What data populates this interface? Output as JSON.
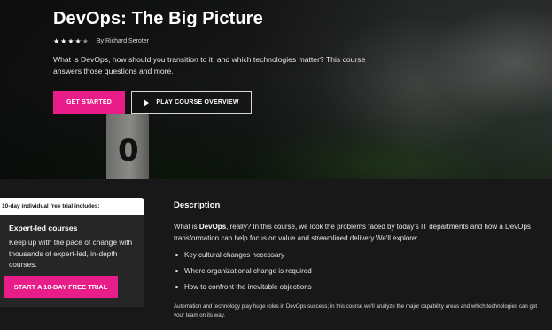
{
  "hero": {
    "title": "DevOps: The Big Picture",
    "rating": {
      "value": 4,
      "max": 5
    },
    "author": "By Richard Seroter",
    "summary": "What is DevOps, how should you transition to it, and which technologies matter? This course answers those questions and more.",
    "get_started_label": "Get started",
    "play_overview_label": "Play course overview",
    "post_digit": "0"
  },
  "trial": {
    "header": "10-day individual free trial includes:",
    "title": "Expert-led courses",
    "text": "Keep up with the pace of change with thousands of expert-led, in-depth courses.",
    "button_label": "Start a 10-day free trial"
  },
  "description": {
    "heading": "Description",
    "intro_prefix": "What is ",
    "intro_bold": "DevOps",
    "intro_rest": ", really? In this course, we look the problems faced by today's IT departments and how a DevOps transformation can help focus on value and streamlined delivery.We'll explore:",
    "bullets": [
      "Key cultural changes necessary",
      "Where organizational change is required",
      "How to confront the inevitable objections"
    ],
    "footer": "Automation and technology play huge roles in DevOps success; in this course we'll analyze the major capability areas and which technologies can get your team on its way."
  },
  "colors": {
    "accent": "#e91d8a",
    "page_background": "#181818",
    "card_background": "#262626"
  }
}
